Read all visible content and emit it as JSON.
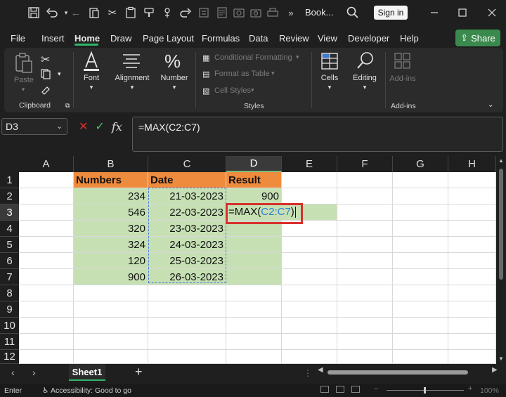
{
  "titlebar": {
    "doc_title": "Book...",
    "signin_label": "Sign in",
    "quick_access_icons": [
      "save-icon",
      "undo-icon",
      "undo-dropdown-icon",
      "back-icon",
      "clipboard-icon",
      "cut-icon",
      "paste-icon",
      "format-painter-icon",
      "more-icon",
      "screenshot-icon",
      "camera-icon",
      "print-icon",
      "overflow-icon"
    ]
  },
  "menu": {
    "tabs": [
      "File",
      "Insert",
      "Home",
      "Draw",
      "Page Layout",
      "Formulas",
      "Data",
      "Review",
      "View",
      "Developer",
      "Help"
    ],
    "active": "Home",
    "share_label": "Share"
  },
  "ribbon": {
    "clipboard": {
      "paste_label": "Paste",
      "group_label": "Clipboard"
    },
    "font": {
      "label": "Font"
    },
    "alignment": {
      "label": "Alignment"
    },
    "number": {
      "label": "Number"
    },
    "styles": {
      "conditional_formatting": "Conditional Formatting",
      "format_as_table": "Format as Table",
      "cell_styles": "Cell Styles",
      "group_label": "Styles"
    },
    "cells": {
      "label": "Cells"
    },
    "editing": {
      "label": "Editing"
    },
    "addins": {
      "label": "Add-ins",
      "group_label": "Add-ins"
    }
  },
  "formula_bar": {
    "name_box": "D3",
    "fx_label": "fx",
    "formula": "=MAX(C2:C7)"
  },
  "grid": {
    "columns": [
      "A",
      "B",
      "C",
      "D",
      "E",
      "F",
      "G",
      "H"
    ],
    "rows": [
      "1",
      "2",
      "3",
      "4",
      "5",
      "6",
      "7",
      "8",
      "9",
      "10",
      "11",
      "12"
    ],
    "headers": {
      "B1": "Numbers",
      "C1": "Date",
      "D1": "Result"
    },
    "numbers": [
      "234",
      "546",
      "320",
      "324",
      "120",
      "900"
    ],
    "dates": [
      "21-03-2023",
      "22-03-2023",
      "23-03-2023",
      "24-03-2023",
      "25-03-2023",
      "26-03-2023"
    ],
    "d2": "900",
    "d3_prefix": "=MAX(",
    "d3_ref": "C2:C7",
    "d3_suffix": ")"
  },
  "sheets": {
    "tabs": [
      "Sheet1"
    ],
    "active": "Sheet1",
    "add_label": "+"
  },
  "status": {
    "mode": "Enter",
    "accessibility": "Accessibility: Good to go",
    "zoom": "100%"
  },
  "colors": {
    "header_orange": "#ef8b3d",
    "data_green": "#c6e0b4",
    "active_border": "#d9302c",
    "ref_blue": "#2e7fd3",
    "share_green": "#3a8a4e"
  }
}
